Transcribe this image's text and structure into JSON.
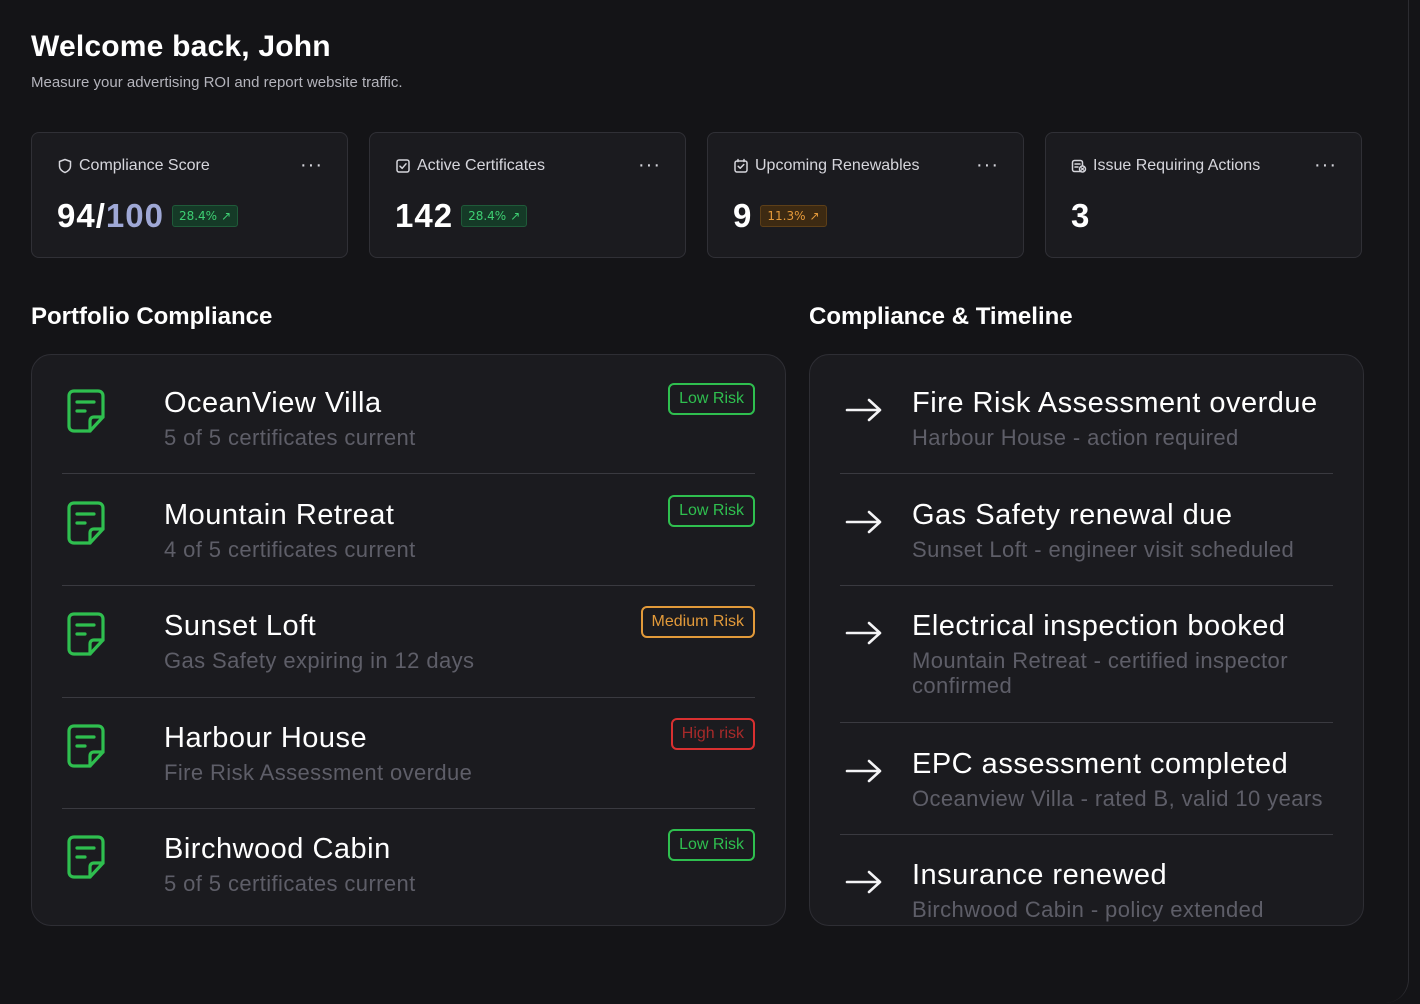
{
  "header": {
    "title": "Welcome back, John",
    "subtitle": "Measure your advertising ROI and report website traffic."
  },
  "stats": [
    {
      "label": "Compliance Score",
      "icon": "shield-icon",
      "value": "94/",
      "value_max": "100",
      "change": "28.4%",
      "change_color": "green"
    },
    {
      "label": "Active Certificates",
      "icon": "checkbox-icon",
      "value": "142",
      "change": "28.4%",
      "change_color": "green"
    },
    {
      "label": "Upcoming Renewables",
      "icon": "calendar-check-icon",
      "value": "9",
      "change": "11.3%",
      "change_color": "orange"
    },
    {
      "label": "Issue Requiring Actions",
      "icon": "alert-document-icon",
      "value": "3"
    }
  ],
  "more_label": "···",
  "change_arrow": "↗",
  "portfolio": {
    "title": "Portfolio Compliance",
    "items": [
      {
        "name": "OceanView Villa",
        "sub": "5 of 5 certificates current",
        "risk": "Low Risk",
        "risk_level": "low"
      },
      {
        "name": "Mountain Retreat",
        "sub": "4 of 5 certificates current",
        "risk": "Low Risk",
        "risk_level": "low"
      },
      {
        "name": "Sunset Loft",
        "sub": "Gas Safety expiring in 12 days",
        "risk": "Medium Risk",
        "risk_level": "medium"
      },
      {
        "name": "Harbour House",
        "sub": "Fire Risk Assessment overdue",
        "risk": "High risk",
        "risk_level": "high"
      },
      {
        "name": "Birchwood Cabin",
        "sub": "5 of 5 certificates current",
        "risk": "Low Risk",
        "risk_level": "low"
      }
    ]
  },
  "timeline": {
    "title": "Compliance & Timeline",
    "items": [
      {
        "title": "Fire Risk Assessment overdue",
        "sub": "Harbour House - action required"
      },
      {
        "title": "Gas Safety renewal due",
        "sub": "Sunset Loft - engineer visit scheduled"
      },
      {
        "title": "Electrical inspection booked",
        "sub": "Mountain Retreat - certified inspector confirmed"
      },
      {
        "title": "EPC assessment completed",
        "sub": "Oceanview Villa - rated B, valid 10 years"
      },
      {
        "title": "Insurance renewed",
        "sub": "Birchwood Cabin - policy extended"
      }
    ]
  },
  "colors": {
    "background": "#141417",
    "card": "#1b1b1f",
    "accent_green": "#2fbf4f",
    "accent_orange": "#e29a3a",
    "accent_red": "#d93030",
    "score_max": "#9fa8d6"
  }
}
